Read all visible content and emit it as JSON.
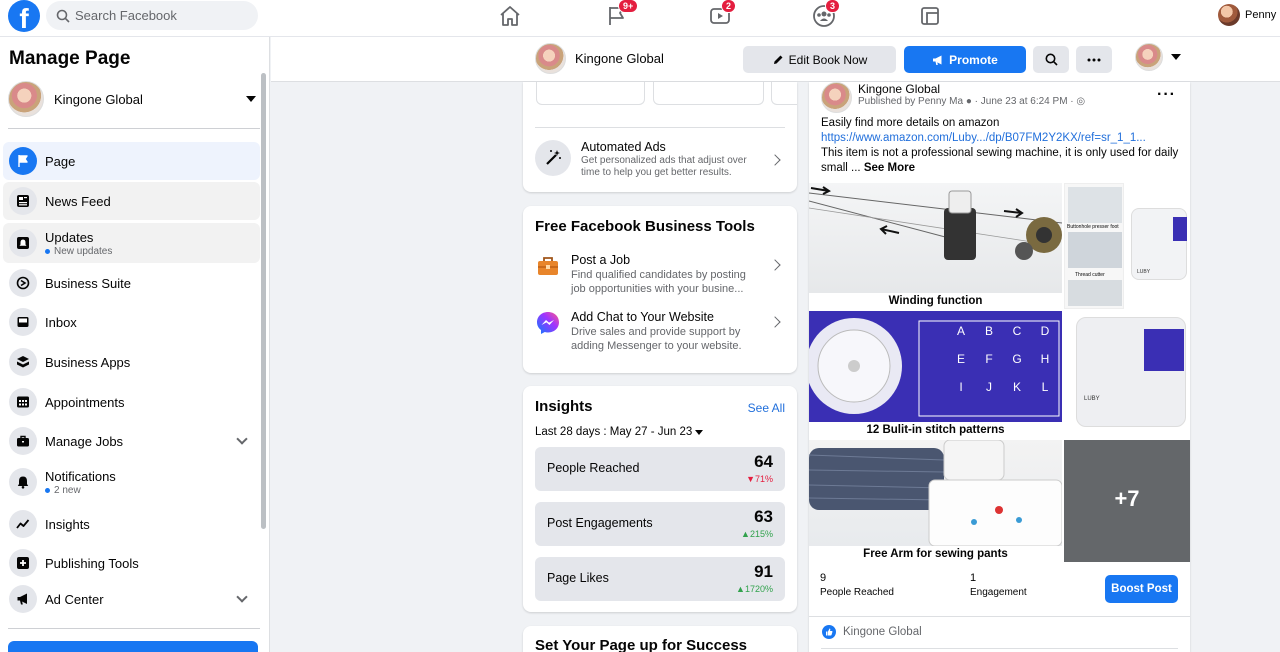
{
  "topbar": {
    "logo": "f",
    "search_placeholder": "Search Facebook",
    "badges": {
      "flag": "9+",
      "watch": "2",
      "groups": "3"
    },
    "user_name": "Penny"
  },
  "sidebar": {
    "title": "Manage Page",
    "page_name": "Kingone Global",
    "items": [
      {
        "label": "Page",
        "icon": "flag-icon"
      },
      {
        "label": "News Feed",
        "icon": "news-feed-icon"
      },
      {
        "label": "Updates",
        "sub": "New updates",
        "icon": "updates-icon"
      },
      {
        "label": "Business Suite",
        "icon": "business-suite-icon"
      },
      {
        "label": "Inbox",
        "icon": "inbox-icon"
      },
      {
        "label": "Business Apps",
        "icon": "business-apps-icon"
      },
      {
        "label": "Appointments",
        "icon": "calendar-icon"
      },
      {
        "label": "Manage Jobs",
        "icon": "briefcase-icon"
      },
      {
        "label": "Notifications",
        "sub": "2 new",
        "icon": "bell-icon"
      },
      {
        "label": "Insights",
        "icon": "insights-icon"
      },
      {
        "label": "Publishing Tools",
        "icon": "publishing-tools-icon"
      },
      {
        "label": "Ad Center",
        "icon": "megaphone-icon"
      }
    ]
  },
  "header": {
    "page_name": "Kingone Global",
    "edit_label": "Edit Book Now",
    "promote_label": "Promote"
  },
  "automated_ads": {
    "title": "Automated Ads",
    "desc": "Get personalized ads that adjust over time to help you get better results."
  },
  "free_tools": {
    "title": "Free Facebook Business Tools",
    "items": [
      {
        "title": "Post a Job",
        "desc": "Find qualified candidates by posting job opportunities with your busine..."
      },
      {
        "title": "Add Chat to Your Website",
        "desc": "Drive sales and provide support by adding Messenger to your website."
      }
    ]
  },
  "insights": {
    "title": "Insights",
    "see_all": "See All",
    "range": "Last 28 days : May 27 - Jun 23",
    "metrics": [
      {
        "label": "People Reached",
        "value": "64",
        "change": "71%",
        "dir": "down"
      },
      {
        "label": "Post Engagements",
        "value": "63",
        "change": "215%",
        "dir": "up"
      },
      {
        "label": "Page Likes",
        "value": "91",
        "change": "1720%",
        "dir": "up"
      }
    ]
  },
  "setup": {
    "title": "Set Your Page up for Success"
  },
  "post": {
    "author": "Kingone Global",
    "meta": "Published by Penny Ma",
    "date": "June 23 at 6:24 PM",
    "line1": "Easily find more details on amazon",
    "link": "https://www.amazon.com/Luby.../dp/B07FM2Y2KX/ref=sr_1_1...",
    "line2": "This item is not a professional sewing machine, it is only used for daily small ...",
    "see_more": "See More",
    "captions": [
      "Winding  function",
      "12 Bulit-in stitch patterns",
      "Free Arm for sewing pants"
    ],
    "thumb_labels": [
      "Buttonhole presser foot",
      "Thread cutter",
      "LUBY",
      "LUBY"
    ],
    "stitch_letters": [
      "A",
      "B",
      "C",
      "D",
      "E",
      "F",
      "G",
      "H",
      "I",
      "J",
      "K",
      "L"
    ],
    "more_count": "+7",
    "reached_value": "9",
    "reached_label": "People Reached",
    "engagement_value": "1",
    "engagement_label": "Engagement",
    "boost_label": "Boost Post",
    "footer_name": "Kingone Global"
  },
  "colors": {
    "brand": "#1877f2",
    "bg": "#f0f2f5",
    "down": "#e41e3f",
    "up": "#31a24c"
  }
}
